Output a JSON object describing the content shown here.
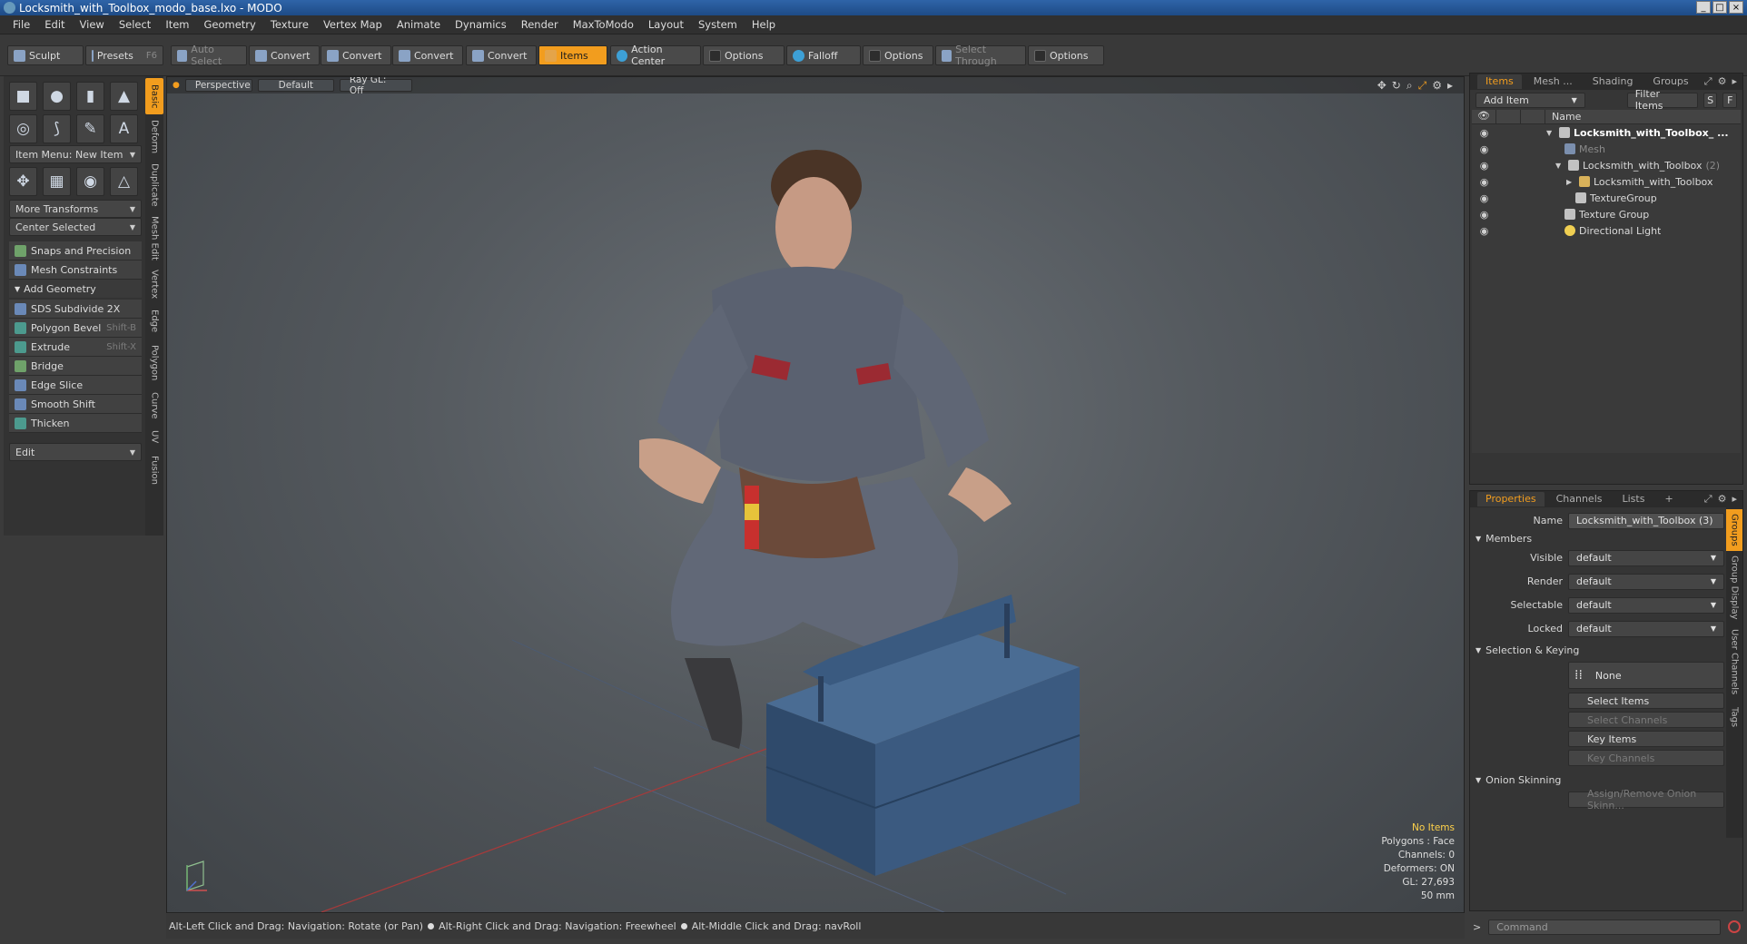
{
  "window": {
    "title": "Locksmith_with_Toolbox_modo_base.lxo - MODO",
    "btn_min": "_",
    "btn_max": "□",
    "btn_close": "×"
  },
  "menu": [
    "File",
    "Edit",
    "View",
    "Select",
    "Item",
    "Geometry",
    "Texture",
    "Vertex Map",
    "Animate",
    "Dynamics",
    "Render",
    "MaxToModo",
    "Layout",
    "System",
    "Help"
  ],
  "toolbar": {
    "sculpt": "Sculpt",
    "presets": "Presets",
    "presets_key": "F6",
    "auto_select": "Auto Select",
    "convert1": "Convert",
    "convert2": "Convert",
    "convert3": "Convert",
    "convert4": "Convert",
    "items": "Items",
    "action_center": "Action Center",
    "options1": "Options",
    "falloff": "Falloff",
    "options2": "Options",
    "select_through": "Select Through",
    "options3": "Options"
  },
  "left": {
    "item_menu": "Item Menu: New Item",
    "more_transforms": "More Transforms",
    "center_selected": "Center Selected",
    "snaps": "Snaps and Precision",
    "mesh_constraints": "Mesh Constraints",
    "add_geometry": "Add Geometry",
    "tools": [
      {
        "label": "SDS Subdivide 2X",
        "key": ""
      },
      {
        "label": "Polygon Bevel",
        "key": "Shift-B"
      },
      {
        "label": "Extrude",
        "key": "Shift-X"
      },
      {
        "label": "Bridge",
        "key": ""
      },
      {
        "label": "Edge Slice",
        "key": ""
      },
      {
        "label": "Smooth Shift",
        "key": ""
      },
      {
        "label": "Thicken",
        "key": ""
      }
    ],
    "edit": "Edit",
    "vtabs": [
      "Basic",
      "Deform",
      "Duplicate",
      "Mesh Edit",
      "Vertex",
      "Edge",
      "Polygon",
      "Curve",
      "UV",
      "Fusion"
    ]
  },
  "viewport": {
    "view": "Perspective",
    "shading": "Default",
    "raygl": "Ray GL: Off",
    "stats": {
      "selection": "No Items",
      "polygons": "Polygons : Face",
      "channels": "Channels: 0",
      "deformers": "Deformers: ON",
      "gl": "GL: 27,693",
      "units": "50 mm"
    }
  },
  "status": {
    "hint1": "Alt-Left Click and Drag: Navigation: Rotate (or Pan)",
    "hint2": "Alt-Right Click and Drag: Navigation: Freewheel",
    "hint3": "Alt-Middle Click and Drag: navRoll"
  },
  "items_panel": {
    "tabs": [
      "Items",
      "Mesh ...",
      "Shading",
      "Groups"
    ],
    "add_item": "Add Item",
    "filter": "Filter Items",
    "btn_s": "S",
    "btn_f": "F",
    "col_name": "Name",
    "rows": [
      {
        "label": "Locksmith_with_Toolbox_ ...",
        "count": ""
      },
      {
        "label": "Mesh",
        "count": ""
      },
      {
        "label": "Locksmith_with_Toolbox",
        "count": "(2)"
      },
      {
        "label": "Locksmith_with_Toolbox",
        "count": ""
      },
      {
        "label": "TextureGroup",
        "count": ""
      },
      {
        "label": "Texture Group",
        "count": ""
      },
      {
        "label": "Directional Light",
        "count": ""
      }
    ]
  },
  "properties": {
    "tabs": [
      "Properties",
      "Channels",
      "Lists"
    ],
    "tab_add": "+",
    "name_label": "Name",
    "name_value": "Locksmith_with_Toolbox (3)",
    "members": "Members",
    "visible_label": "Visible",
    "visible": "default",
    "render_label": "Render",
    "render": "default",
    "selectable_label": "Selectable",
    "selectable": "default",
    "locked_label": "Locked",
    "locked": "default",
    "sel_keying": "Selection & Keying",
    "none": "None",
    "select_items": "Select Items",
    "select_channels": "Select Channels",
    "key_items": "Key Items",
    "key_channels": "Key Channels",
    "onion": "Onion Skinning",
    "assign_onion": "Assign/Remove Onion Skinn...",
    "vtabs": [
      "Groups",
      "Group Display",
      "User Channels",
      "Tags"
    ]
  },
  "command": {
    "prompt": ">",
    "placeholder": "Command"
  },
  "colors": {
    "accent": "#f29d1e",
    "toolbox_blue": "#3f5f86",
    "selection_yellow": "#ffd24a"
  }
}
